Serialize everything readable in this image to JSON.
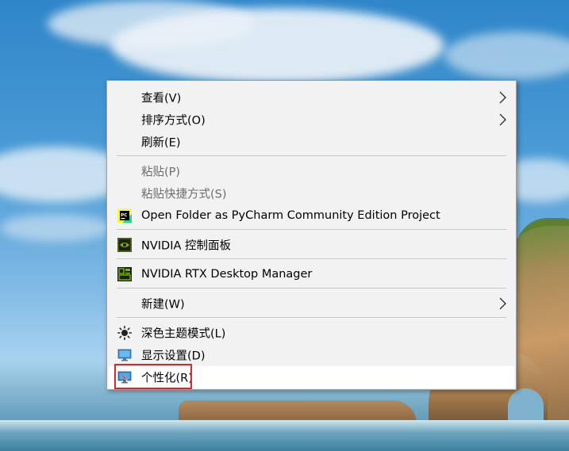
{
  "context_menu": {
    "items": [
      {
        "label": "查看(V)",
        "has_submenu": true,
        "disabled": false
      },
      {
        "label": "排序方式(O)",
        "has_submenu": true,
        "disabled": false
      },
      {
        "label": "刷新(E)",
        "has_submenu": false,
        "disabled": false
      },
      {
        "label": "粘贴(P)",
        "has_submenu": false,
        "disabled": true
      },
      {
        "label": "粘贴快捷方式(S)",
        "has_submenu": false,
        "disabled": true
      },
      {
        "label": "Open Folder as PyCharm Community Edition Project",
        "icon": "pycharm-icon",
        "disabled": false
      },
      {
        "label": "NVIDIA 控制面板",
        "icon": "nvidia-control-panel-icon",
        "disabled": false
      },
      {
        "label": "NVIDIA RTX Desktop Manager",
        "icon": "nvidia-rtx-desktop-manager-icon",
        "disabled": false
      },
      {
        "label": "新建(W)",
        "has_submenu": true,
        "disabled": false
      },
      {
        "label": "深色主题模式(L)",
        "icon": "sun-icon",
        "disabled": false
      },
      {
        "label": "显示设置(D)",
        "icon": "display-icon",
        "disabled": false
      },
      {
        "label": "个性化(R)",
        "icon": "personalize-icon",
        "disabled": false,
        "highlighted": true
      }
    ]
  },
  "colors": {
    "menu_background": "#f2f2f2",
    "highlight_border": "#e0242c",
    "disabled_text": "#6d6d6d"
  }
}
